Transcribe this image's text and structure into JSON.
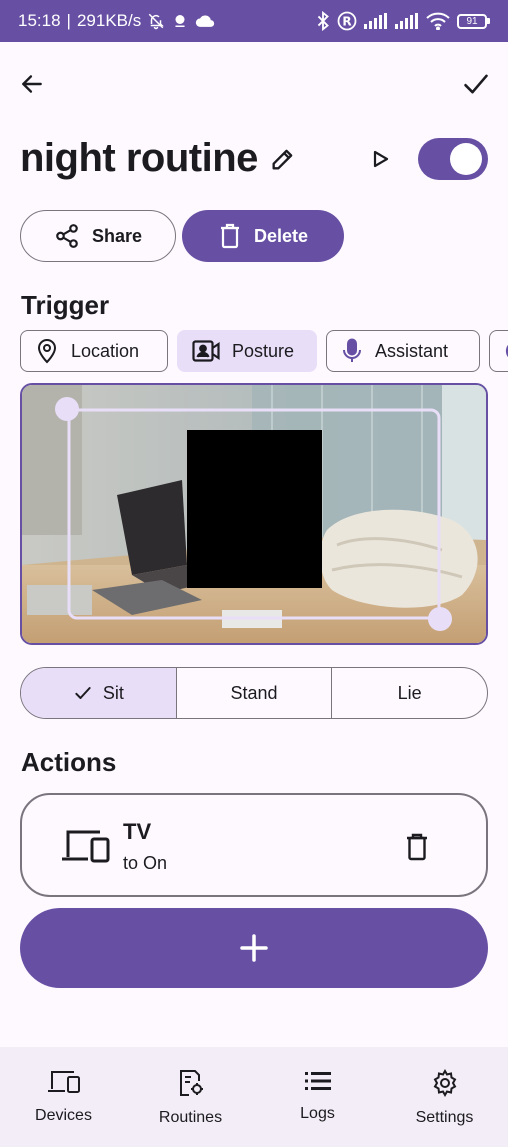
{
  "status_bar": {
    "time": "15:18",
    "network_speed": "291KB/s",
    "battery": "91",
    "icons": [
      "muted-bell-icon",
      "notification-dot-icon",
      "cloud-icon",
      "bluetooth-icon",
      "registered-icon",
      "signal-icon",
      "signal-icon",
      "wifi-icon",
      "battery-icon"
    ]
  },
  "app_bar": {
    "back_icon": "arrow-left-icon",
    "confirm_icon": "check-icon"
  },
  "routine": {
    "title": "night routine",
    "enabled": true
  },
  "buttons": {
    "share_label": "Share",
    "delete_label": "Delete"
  },
  "trigger": {
    "title": "Trigger",
    "chips": [
      {
        "label": "Location",
        "icon": "location-pin-icon",
        "selected": false
      },
      {
        "label": "Posture",
        "icon": "video-person-icon",
        "selected": true
      },
      {
        "label": "Assistant",
        "icon": "microphone-icon",
        "selected": false
      }
    ],
    "postures": [
      {
        "label": "Sit",
        "selected": true
      },
      {
        "label": "Stand",
        "selected": false
      },
      {
        "label": "Lie",
        "selected": false
      }
    ]
  },
  "actions": {
    "title": "Actions",
    "items": [
      {
        "device": "TV",
        "state": "to On",
        "icon": "devices-icon"
      }
    ]
  },
  "bottom_nav": {
    "items": [
      {
        "label": "Devices",
        "icon": "devices-icon"
      },
      {
        "label": "Routines",
        "icon": "routines-icon"
      },
      {
        "label": "Logs",
        "icon": "list-icon"
      },
      {
        "label": "Settings",
        "icon": "gear-icon"
      }
    ]
  },
  "colors": {
    "primary": "#6750a4",
    "secondary_container": "#e8def8",
    "outline": "#79747e",
    "background": "#fdf9ff",
    "nav_background": "#f3edf7"
  }
}
